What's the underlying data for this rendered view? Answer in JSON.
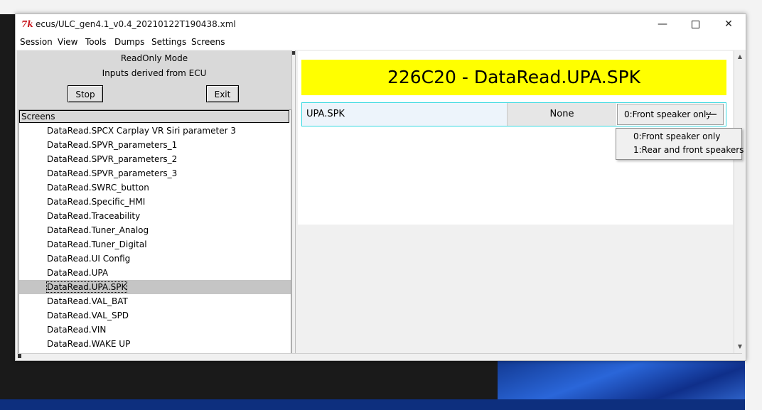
{
  "window": {
    "title": "ecus/ULC_gen4.1_v0.4_20210122T190438.xml",
    "app_icon_glyph": "7k",
    "controls": {
      "minimize": "—",
      "close": "✕"
    }
  },
  "menu": [
    "Session",
    "View",
    "Tools",
    "Dumps",
    "Settings",
    "Screens"
  ],
  "left_panel": {
    "mode": "ReadOnly Mode",
    "inputs_source": "Inputs derived from ECU",
    "stop_label": "Stop",
    "exit_label": "Exit",
    "list_header": "Screens",
    "items": [
      "DataRead.SPCX Carplay VR Siri parameter 3",
      "DataRead.SPVR_parameters_1",
      "DataRead.SPVR_parameters_2",
      "DataRead.SPVR_parameters_3",
      "DataRead.SWRC_button",
      "DataRead.Specific_HMI",
      "DataRead.Traceability",
      "DataRead.Tuner_Analog",
      "DataRead.Tuner_Digital",
      "DataRead.UI Config",
      "DataRead.UPA",
      "DataRead.UPA.SPK",
      "DataRead.VAL_BAT",
      "DataRead.VAL_SPD",
      "DataRead.VIN",
      "DataRead.WAKE UP"
    ],
    "selected_item": "DataRead.UPA.SPK"
  },
  "right_panel": {
    "banner": "226C20 - DataRead.UPA.SPK",
    "banner_color": "#ffff00",
    "param": {
      "label": "UPA.SPK",
      "value": "None",
      "selected_option": "0:Front speaker only",
      "options": [
        "0:Front speaker only",
        "1:Rear and front speakers"
      ]
    },
    "row_border_color": "#35d8e0"
  }
}
